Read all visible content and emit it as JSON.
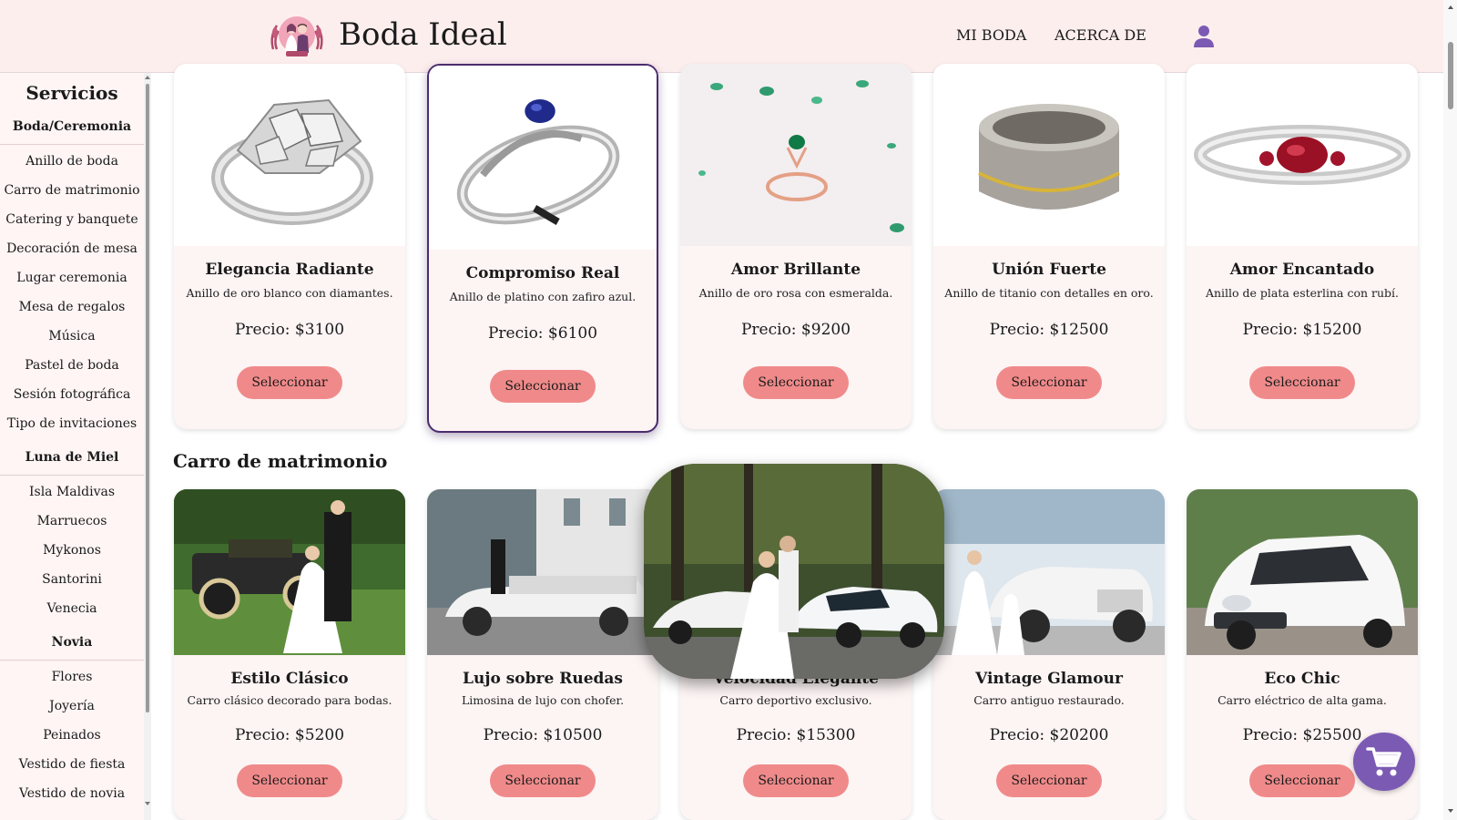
{
  "header": {
    "brand": "Boda Ideal",
    "nav": [
      {
        "label": "MI BODA"
      },
      {
        "label": "ACERCA DE"
      }
    ]
  },
  "sidebar": {
    "title": "Servicios",
    "groups": [
      {
        "label": "Boda/Ceremonia",
        "items": [
          "Anillo de boda",
          "Carro de matrimonio",
          "Catering y banquete",
          "Decoración de mesa",
          "Lugar ceremonia",
          "Mesa de regalos",
          "Música",
          "Pastel de boda",
          "Sesión fotográfica",
          "Tipo de invitaciones"
        ]
      },
      {
        "label": "Luna de Miel",
        "items": [
          "Isla Maldivas",
          "Marruecos",
          "Mykonos",
          "Santorini",
          "Venecia"
        ]
      },
      {
        "label": "Novia",
        "items": [
          "Flores",
          "Joyería",
          "Peinados",
          "Vestido de fiesta",
          "Vestido de novia"
        ]
      }
    ]
  },
  "rings": [
    {
      "title": "Elegancia Radiante",
      "desc": "Anillo de oro blanco con diamantes.",
      "price": "Precio: $3100",
      "button": "Seleccionar",
      "selected": false
    },
    {
      "title": "Compromiso Real",
      "desc": "Anillo de platino con zafiro azul.",
      "price": "Precio: $6100",
      "button": "Seleccionar",
      "selected": true
    },
    {
      "title": "Amor Brillante",
      "desc": "Anillo de oro rosa con esmeralda.",
      "price": "Precio: $9200",
      "button": "Seleccionar",
      "selected": false
    },
    {
      "title": "Unión Fuerte",
      "desc": "Anillo de titanio con detalles en oro.",
      "price": "Precio: $12500",
      "button": "Seleccionar",
      "selected": false
    },
    {
      "title": "Amor Encantado",
      "desc": "Anillo de plata esterlina con rubí.",
      "price": "Precio: $15200",
      "button": "Seleccionar",
      "selected": false
    }
  ],
  "cars_section": {
    "title": "Carro de matrimonio",
    "items": [
      {
        "title": "Estilo Clásico",
        "desc": "Carro clásico decorado para bodas.",
        "price": "Precio: $5200",
        "button": "Seleccionar"
      },
      {
        "title": "Lujo sobre Ruedas",
        "desc": "Limosina de lujo con chofer.",
        "price": "Precio: $10500",
        "button": "Seleccionar"
      },
      {
        "title": "Velocidad Elegante",
        "desc": "Carro deportivo exclusivo.",
        "price": "Precio: $15300",
        "button": "Seleccionar"
      },
      {
        "title": "Vintage Glamour",
        "desc": "Carro antiguo restaurado.",
        "price": "Precio: $20200",
        "button": "Seleccionar"
      },
      {
        "title": "Eco Chic",
        "desc": "Carro eléctrico de alta gama.",
        "price": "Precio: $25500",
        "button": "Seleccionar"
      }
    ]
  },
  "icons": {
    "logo": "couple-logo-icon",
    "user": "user-icon",
    "cart": "cart-icon"
  },
  "colors": {
    "header_bg": "#fdeeee",
    "button": "#f08a8a",
    "accent": "#7b5ab3",
    "selected_border": "#4b2c6e"
  }
}
